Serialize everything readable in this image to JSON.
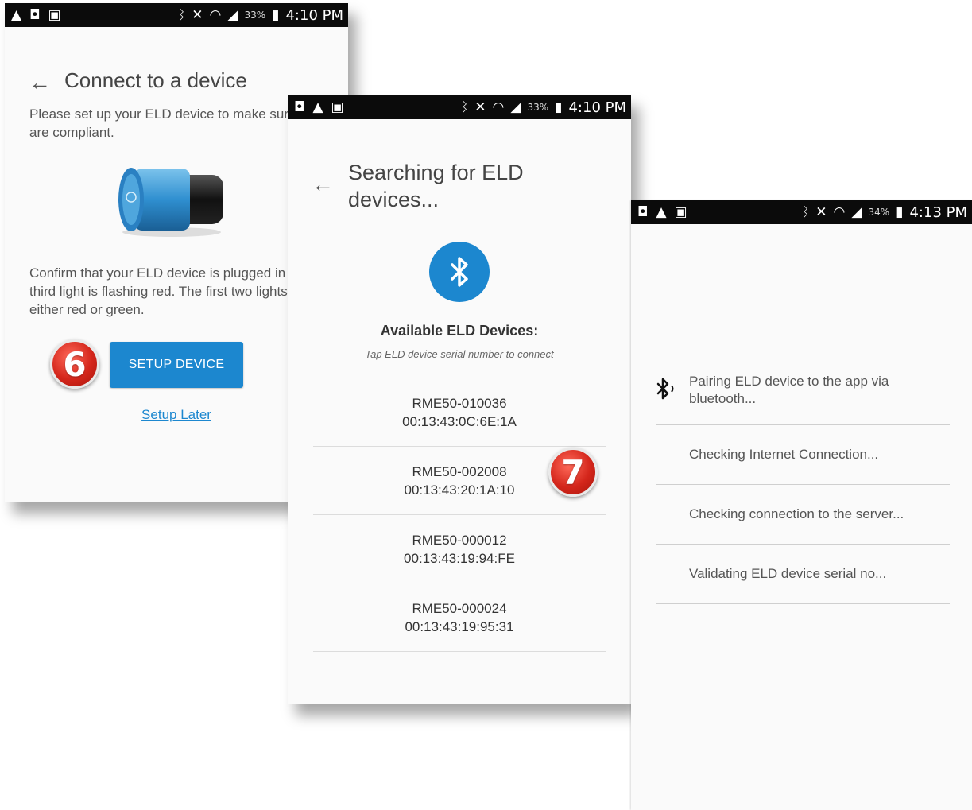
{
  "screen1": {
    "status": {
      "battery": "33%",
      "time": "4:10 PM"
    },
    "title": "Connect to a device",
    "intro": "Please set up your ELD device to make sure your logs are compliant.",
    "confirm": "Confirm that your ELD device is plugged in and the third light is flashing red. The first two lights can be either red or green.",
    "step_badge": "6",
    "setup_button": "SETUP DEVICE",
    "setup_later": "Setup Later"
  },
  "screen2": {
    "status": {
      "battery": "33%",
      "time": "4:10 PM"
    },
    "title": "Searching for ELD devices...",
    "available_label": "Available ELD Devices:",
    "hint": "Tap ELD device serial number to connect",
    "step_badge": "7",
    "devices": [
      {
        "serial": "RME50-010036",
        "mac": "00:13:43:0C:6E:1A"
      },
      {
        "serial": "RME50-002008",
        "mac": "00:13:43:20:1A:10"
      },
      {
        "serial": "RME50-000012",
        "mac": "00:13:43:19:94:FE"
      },
      {
        "serial": "RME50-000024",
        "mac": "00:13:43:19:95:31"
      }
    ]
  },
  "screen3": {
    "status": {
      "battery": "34%",
      "time": "4:13 PM"
    },
    "steps": [
      {
        "text": "Pairing ELD device to the app via bluetooth...",
        "icon": "bluetooth-pairing-icon"
      },
      {
        "text": "Checking Internet Connection..."
      },
      {
        "text": "Checking connection to the server..."
      },
      {
        "text": "Validating ELD device serial no..."
      }
    ]
  }
}
